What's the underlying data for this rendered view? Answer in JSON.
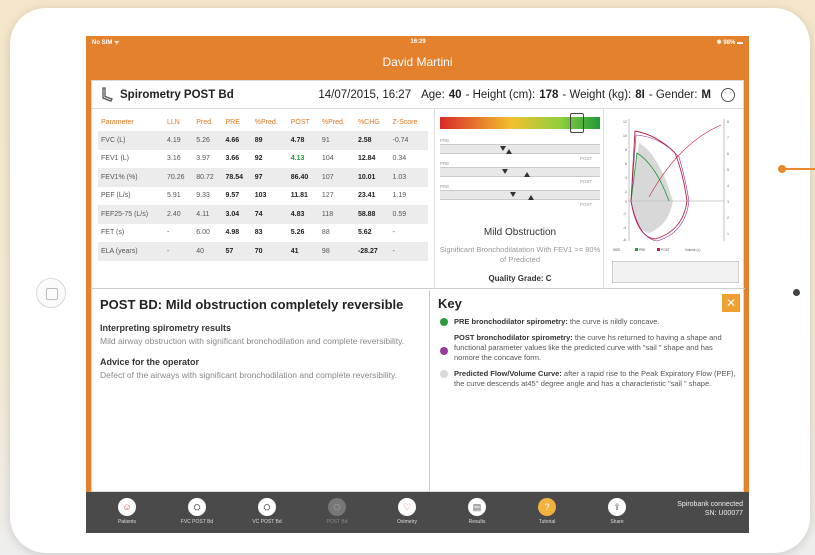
{
  "status_bar": {
    "carrier": "No SIM ᯤ",
    "time": "16:29",
    "battery": "✱ 98% ▬"
  },
  "patient_name": "David Martini",
  "header": {
    "title": "Spirometry POST Bd",
    "datetime": "14/07/2015, 16:27",
    "age_label": "Age:",
    "age": "40",
    "height_label": "- Height (cm):",
    "height": "178",
    "weight_label": "- Weight (kg):",
    "weight": "8I",
    "gender_label": "- Gender:",
    "gender": "M"
  },
  "table": {
    "columns": [
      "Parameter",
      "LLN",
      "Pred.",
      "PRE",
      "%Pred.",
      "POST",
      "%Pred.",
      "%CHG",
      "Z-Score"
    ],
    "rows": [
      [
        "FVC (L)",
        "4.19",
        "5.26",
        "4.66",
        "89",
        "4.78",
        "91",
        "2.58",
        "-0.74"
      ],
      [
        "FEV1 (L)",
        "3.16",
        "3.97",
        "3.66",
        "92",
        "4.13",
        "104",
        "12.84",
        "0.34"
      ],
      [
        "FEV1% (%)",
        "70.26",
        "80.72",
        "78.54",
        "97",
        "86.40",
        "107",
        "10.01",
        "1.03"
      ],
      [
        "PEF (L/s)",
        "5.91",
        "9.33",
        "9.57",
        "103",
        "11.81",
        "127",
        "23.41",
        "1.19"
      ],
      [
        "FEF25-75 (L/s)",
        "2.40",
        "4.11",
        "3.04",
        "74",
        "4.83",
        "118",
        "58.88",
        "0.59"
      ],
      [
        "FET (s)",
        "-",
        "6.00",
        "4.98",
        "83",
        "5.26",
        "88",
        "5.62",
        "-"
      ],
      [
        "ELA (years)",
        "-",
        "40",
        "57",
        "70",
        "41",
        "98",
        "-28.27",
        "-"
      ]
    ]
  },
  "gauge": {
    "pre_label": "PRE",
    "post_label": "POST",
    "diagnosis": "Mild Obstruction",
    "diagnosis_detail": "Significant Bronchodilatation With FEV1 >= 80% of Predicted",
    "quality_grade": "Quality Grade: C"
  },
  "interpretation": {
    "title": "POST BD: Mild obstruction completely reversible",
    "section1_title": "Interpreting spirometry results",
    "section1_text": "Mild airway obstruction with significant bronchodilation and complete reversibility.",
    "section2_title": "Advice for the operator",
    "section2_text": "Defect of the airways with significant bronchodilation and complete reversibility."
  },
  "key": {
    "title": "Key",
    "close": "✕",
    "items": [
      {
        "label": "PRE bronchodilator spirometry:",
        "text": " the curve is nildly concave.",
        "color": "#2a9a3a"
      },
      {
        "label": "POST bronchodilator spirometry:",
        "text": " the curve hs returned to having a shape and functional parameter values like the predicted curve with \"sail \" shape and has nomore the concave form.",
        "color": "#9a3a9a"
      },
      {
        "label": "Predicted Flow/Volume Curve:",
        "text": " after a rapid rise to the Peak Expiratory Flow (PEF), the curve descends at45° degree angle and has a characteristic \"sail \" shape.",
        "color": "#d8d8d8"
      }
    ]
  },
  "tabs": [
    {
      "label": "Patients",
      "icon": "☺",
      "state": "red"
    },
    {
      "label": "FVC POST Bd",
      "icon": "⛭",
      "state": ""
    },
    {
      "label": "VC POST Bd",
      "icon": "⛭",
      "state": ""
    },
    {
      "label": "POST Bd",
      "icon": "⛭",
      "state": "disabled"
    },
    {
      "label": "Oximetry",
      "icon": "♡",
      "state": "red"
    },
    {
      "label": "Results",
      "icon": "▤",
      "state": ""
    },
    {
      "label": "Tutorial",
      "icon": "?",
      "state": "active"
    },
    {
      "label": "Share",
      "icon": "⇪",
      "state": ""
    }
  ],
  "device": {
    "status": "Spirobank connected",
    "serial": "SN: U00077"
  },
  "colors": {
    "accent": "#e4812c",
    "tabbar": "#4a4a4a",
    "pre": "#2a9a3a",
    "post": "#c02040",
    "predicted": "#999999"
  }
}
